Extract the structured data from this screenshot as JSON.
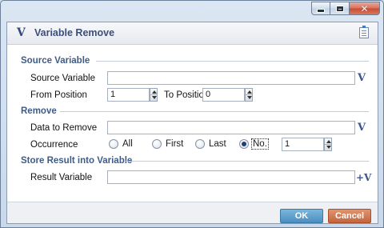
{
  "window": {
    "controls": {
      "minimize_icon": "minimize-icon",
      "maximize_icon": "maximize-icon",
      "close_icon": "close-icon",
      "close_glyph": "✕"
    }
  },
  "header": {
    "logo": "V",
    "title": "Variable Remove",
    "doc_icon": "document-icon"
  },
  "sections": {
    "source": {
      "title": "Source Variable",
      "source_variable_label": "Source Variable",
      "source_variable_value": "",
      "from_position_label": "From Position",
      "from_position_value": "1",
      "to_position_label": "To Position",
      "to_position_value": "0"
    },
    "remove": {
      "title": "Remove",
      "data_to_remove_label": "Data to Remove",
      "data_to_remove_value": "",
      "occurrence_label": "Occurrence",
      "options": [
        "All",
        "First",
        "Last",
        "No."
      ],
      "selected": "No.",
      "occurrence_number": "1"
    },
    "store": {
      "title": "Store Result into Variable",
      "result_variable_label": "Result Variable",
      "result_variable_value": ""
    }
  },
  "variable_icon_glyph": "V",
  "add_variable_icon_glyph": "+V",
  "footer": {
    "ok_label": "OK",
    "cancel_label": "Cancel"
  },
  "colors": {
    "section_title": "#3e5c86",
    "ok_button": "#4a8fc1",
    "cancel_button": "#c4643c",
    "variable_icon": "#3c5491"
  }
}
